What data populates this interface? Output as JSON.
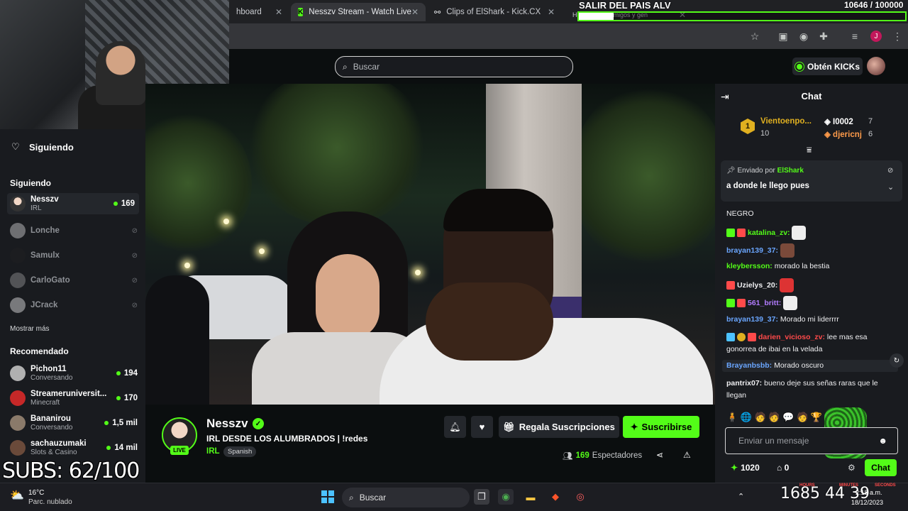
{
  "browser": {
    "tabs": [
      {
        "title": "hboard",
        "close": "✕"
      },
      {
        "title": "Nesszv Stream - Watch Live",
        "close": "✕"
      },
      {
        "title": "Clips of ElShark - Kick.CX",
        "close": "✕"
      },
      {
        "title": "Hola conoce amigos y gen",
        "close": "✕"
      }
    ]
  },
  "overlay": {
    "goal_title": "SALIR DEL PAIS ALV",
    "goal_count": "10646  /  100000",
    "goal_progress": 0.106,
    "subs": "SUBS: 62/100",
    "clock_big": "1685   44  39",
    "labels": [
      "HOURS",
      "MINUTES",
      "SECONDS"
    ]
  },
  "nav": {
    "search_placeholder": "Buscar",
    "kicks_label": "Obtén KICKs"
  },
  "sidebar": {
    "following_title": "Siguiendo",
    "following_head": "Siguiendo",
    "following": [
      {
        "name": "Nesszv",
        "sub": "IRL",
        "count": "169",
        "live": true
      },
      {
        "name": "Lonche",
        "live": false
      },
      {
        "name": "Samulx",
        "live": false
      },
      {
        "name": "CarloGato",
        "live": false
      },
      {
        "name": "JCrack",
        "live": false
      }
    ],
    "show_more": "Mostrar más",
    "recommended_head": "Recomendado",
    "recommended": [
      {
        "name": "Pichon11",
        "sub": "Conversando",
        "count": "194"
      },
      {
        "name": "Streameruniversit...",
        "sub": "Minecraft",
        "count": "170"
      },
      {
        "name": "Bananirou",
        "sub": "Conversando",
        "count": "1,5 mil"
      },
      {
        "name": "sachauzumaki",
        "sub": "Slots & Casino",
        "count": "14 mil"
      }
    ]
  },
  "stream": {
    "streamer": "Nesszv",
    "live_badge": "LIVE",
    "title": "IRL DESDE LOS ALUMBRADOS | !redes",
    "category": "IRL",
    "language": "Spanish",
    "gift_label": "Regala Suscripciones",
    "subscribe_label": "Suscribirse",
    "viewers_count": "169",
    "viewers_label": "Espectadores"
  },
  "chat": {
    "title": "Chat",
    "leaderboard": [
      {
        "rank": "1",
        "name": "Vientoenpo...",
        "score": "10"
      },
      {
        "name": "I0002",
        "score": "7"
      },
      {
        "name": "djericnj",
        "score": "6"
      }
    ],
    "pinned_prefix": "Enviado por",
    "pinned_author": "ElShark",
    "pinned_message": "a donde le llego pues",
    "messages": [
      {
        "user": "",
        "text": "NEGRO",
        "color": "#53fc18"
      },
      {
        "user": "katalina_zv:",
        "text": "",
        "color": "#53fc18"
      },
      {
        "user": "brayan139_37:",
        "text": "",
        "color": "#6aa6ff"
      },
      {
        "user": "kleybersson:",
        "text": "morado la bestia",
        "color": "#53fc18"
      },
      {
        "user": "Uzielys_20:",
        "text": "",
        "color": "#ffffff"
      },
      {
        "user": "561_britt:",
        "text": "",
        "color": "#b27cff"
      },
      {
        "user": "brayan139_37:",
        "text": "Morado mi liderrrr",
        "color": "#6aa6ff"
      },
      {
        "user": "darien_vicioso_zv:",
        "text": "lee mas esa gonorrea de ibai en la velada",
        "color": "#ff4a4a"
      },
      {
        "user": "Brayanbsbb:",
        "text": "Morado oscuro",
        "color": "#6aa6ff"
      },
      {
        "user": "pantrix07:",
        "text": "bueno deje sus señas raras que le llegan",
        "color": "#ffffff"
      }
    ],
    "input_placeholder": "Enviar un mensaje",
    "points": "1020",
    "shop_count": "0",
    "send_label": "Chat"
  },
  "taskbar": {
    "temp": "16°C",
    "weather": "Parc. nublado",
    "search": "Buscar",
    "time": "2:18 a.m.",
    "date": "18/12/2023"
  }
}
